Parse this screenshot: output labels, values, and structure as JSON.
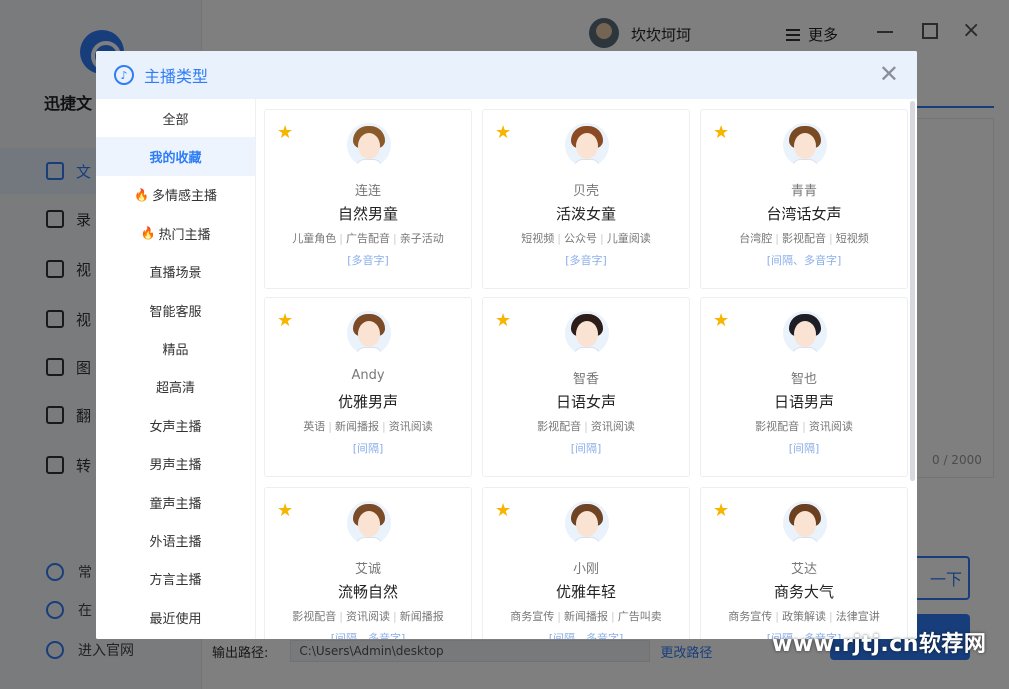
{
  "app": {
    "name": "迅捷文",
    "nav": [
      {
        "label": "文",
        "icon": "text-icon",
        "active": true
      },
      {
        "label": "录",
        "icon": "record-icon"
      },
      {
        "label": "视",
        "icon": "video-icon"
      },
      {
        "label": "视",
        "icon": "video-edit-icon"
      },
      {
        "label": "图",
        "icon": "image-icon"
      },
      {
        "label": "翻",
        "icon": "translate-icon"
      },
      {
        "label": "转",
        "icon": "convert-icon"
      }
    ],
    "bottom_links": [
      {
        "label": "常",
        "icon": "help-icon"
      },
      {
        "label": "在",
        "icon": "headset-icon"
      },
      {
        "label": "进入官网",
        "icon": "monitor-icon"
      }
    ],
    "user_name": "坎坎坷坷",
    "more_label": "更多",
    "char_count": "0 / 2000",
    "next_label": "一下",
    "output_label": "输出路径:",
    "output_path": "C:\\Users\\Admin\\desktop",
    "change_path_label": "更改路径"
  },
  "modal": {
    "title": "主播类型",
    "categories": [
      {
        "label": "全部"
      },
      {
        "label": "我的收藏",
        "active": true
      },
      {
        "label": "多情感主播",
        "hot": true
      },
      {
        "label": "热门主播",
        "hot": true
      },
      {
        "label": "直播场景"
      },
      {
        "label": "智能客服"
      },
      {
        "label": "精品"
      },
      {
        "label": "超高清"
      },
      {
        "label": "女声主播"
      },
      {
        "label": "男声主播"
      },
      {
        "label": "童声主播"
      },
      {
        "label": "外语主播"
      },
      {
        "label": "方言主播"
      },
      {
        "label": "最近使用"
      }
    ],
    "voices": [
      {
        "speaker": "连连",
        "title": "自然男童",
        "tags": [
          "儿童角色",
          "广告配音",
          "亲子活动"
        ],
        "feature": "[多音字]",
        "hair": "#8a5a2b"
      },
      {
        "speaker": "贝壳",
        "title": "活泼女童",
        "tags": [
          "短视频",
          "公众号",
          "儿童阅读"
        ],
        "feature": "[多音字]",
        "hair": "#8a4a24"
      },
      {
        "speaker": "青青",
        "title": "台湾话女声",
        "tags": [
          "台湾腔",
          "影视配音",
          "短视频"
        ],
        "feature": "[间隔、多音字]",
        "hair": "#7a4a22"
      },
      {
        "speaker": "Andy",
        "title": "优雅男声",
        "tags": [
          "英语",
          "新闻播报",
          "资讯阅读"
        ],
        "feature": "[间隔]",
        "hair": "#7b4a26"
      },
      {
        "speaker": "智香",
        "title": "日语女声",
        "tags": [
          "影视配音",
          "资讯阅读"
        ],
        "feature": "[间隔]",
        "hair": "#2d1d18"
      },
      {
        "speaker": "智也",
        "title": "日语男声",
        "tags": [
          "影视配音",
          "资讯阅读"
        ],
        "feature": "[间隔]",
        "hair": "#1e1e26"
      },
      {
        "speaker": "艾诚",
        "title": "流畅自然",
        "tags": [
          "影视配音",
          "资讯阅读",
          "新闻播报"
        ],
        "feature": "[间隔、多音字]",
        "hair": "#7b4a26"
      },
      {
        "speaker": "小刚",
        "title": "优雅年轻",
        "tags": [
          "商务宣传",
          "新闻播报",
          "广告叫卖"
        ],
        "feature": "[间隔、多音字]",
        "hair": "#6e4424"
      },
      {
        "speaker": "艾达",
        "title": "商务大气",
        "tags": [
          "商务宣传",
          "政策解读",
          "法律宣讲"
        ],
        "feature": "[间隔、多音字]",
        "hair": "#6a4020"
      }
    ]
  },
  "watermark": "www.rjtj.cn软荐网",
  "colors": {
    "accent": "#2f7df6",
    "star": "#f7b500",
    "hot": "#f04a2f"
  }
}
